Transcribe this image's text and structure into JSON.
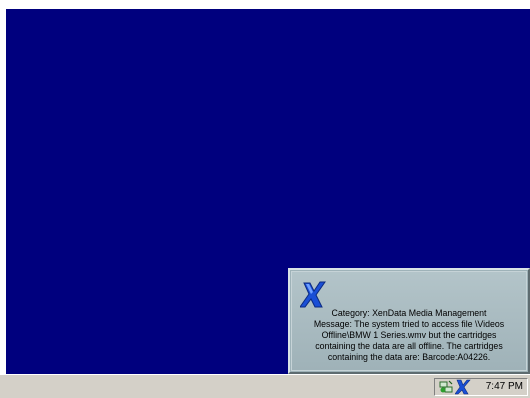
{
  "desktop": {
    "background_color": "#00007e"
  },
  "notification": {
    "icon": "xendata-icon",
    "lines": [
      "Category: XenData Media Management",
      "Message: The system tried to access file \\Videos",
      "Offline\\BMW 1 Series.wmv but the cartridges",
      "containing the data are all offline.  The cartridges",
      "containing the data are: Barcode:A04226."
    ]
  },
  "taskbar": {
    "tray_icons": [
      "network-icon",
      "xendata-icon"
    ],
    "clock": "7:47 PM"
  }
}
